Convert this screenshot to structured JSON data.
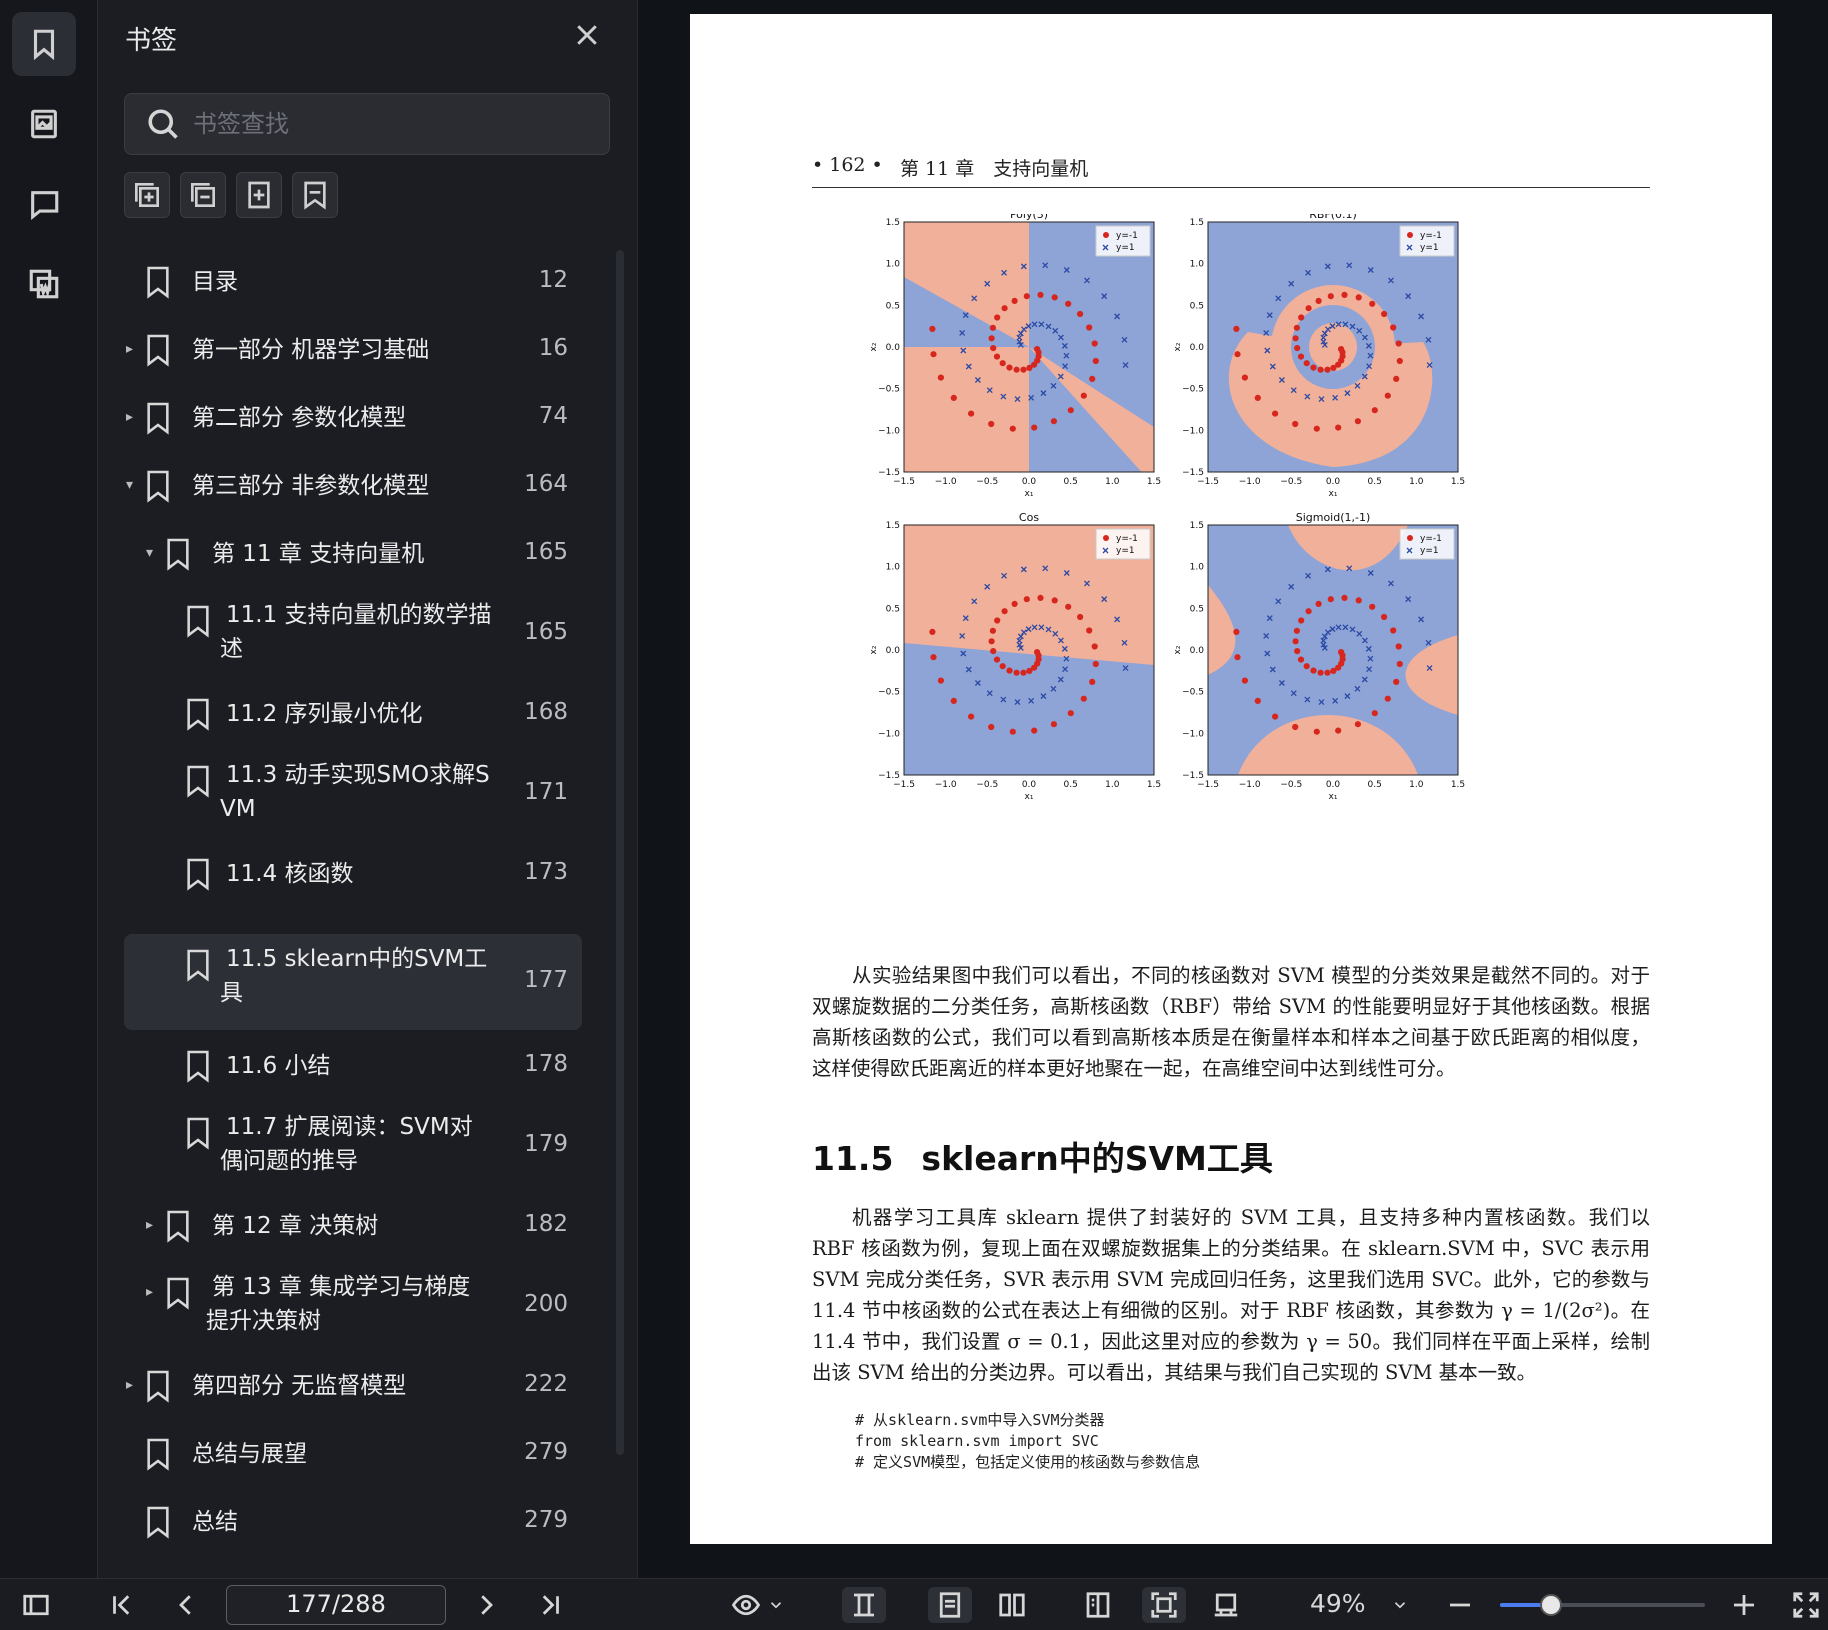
{
  "panel": {
    "title": "书签",
    "search_placeholder": "书签查找",
    "items": [
      {
        "label": "目录",
        "page": "12"
      },
      {
        "label": "第一部分 机器学习基础",
        "page": "16"
      },
      {
        "label": "第二部分 参数化模型",
        "page": "74"
      },
      {
        "label": "第三部分 非参数化模型",
        "page": "164"
      },
      {
        "label": "第 11 章 支持向量机",
        "page": "165"
      },
      {
        "label": "11.1 支持向量机的数学描",
        "label2": "述",
        "page": "165"
      },
      {
        "label": "11.2 序列最小优化",
        "page": "168"
      },
      {
        "label": "11.3 动手实现SMO求解S",
        "label2": "VM",
        "page": "171"
      },
      {
        "label": "11.4 核函数",
        "page": "173"
      },
      {
        "label": "11.5 sklearn中的SVM工",
        "label2": "具",
        "page": "177"
      },
      {
        "label": "11.6 小结",
        "page": "178"
      },
      {
        "label": "11.7 扩展阅读：SVM对",
        "label2": "偶问题的推导",
        "page": "179"
      },
      {
        "label": "第 12 章 决策树",
        "page": "182"
      },
      {
        "label": "第 13 章 集成学习与梯度",
        "label2": "提升决策树",
        "page": "200"
      },
      {
        "label": "第四部分 无监督模型",
        "page": "222"
      },
      {
        "label": "总结与展望",
        "page": "279"
      },
      {
        "label": "总结",
        "page": "279"
      }
    ]
  },
  "document": {
    "page_number": "• 162 •",
    "chapter_head": "第 11 章　支持向量机",
    "figure": {
      "panels": [
        {
          "title": "Poly(3)"
        },
        {
          "title": "RBF(0.1)"
        },
        {
          "title": "Cos"
        },
        {
          "title": "Sigmoid(1,-1)"
        }
      ],
      "legend": [
        "y=-1",
        "y=1"
      ],
      "ticks": [
        "−1.5",
        "−1.0",
        "−0.5",
        "0.0",
        "0.5",
        "1.0",
        "1.5"
      ],
      "xlabel": "x₁",
      "ylabel": "x₂"
    },
    "para1": "从实验结果图中我们可以看出，不同的核函数对 SVM 模型的分类效果是截然不同的。对于双螺旋数据的二分类任务，高斯核函数（RBF）带给 SVM 的性能要明显好于其他核函数。根据高斯核函数的公式，我们可以看到高斯核本质是在衡量样本和样本之间基于欧氏距离的相似度，这样使得欧氏距离近的样本更好地聚在一起，在高维空间中达到线性可分。",
    "section_num": "11.5",
    "section_title": "sklearn中的SVM工具",
    "para2": "机器学习工具库 sklearn 提供了封装好的 SVM 工具，且支持多种内置核函数。我们以 RBF 核函数为例，复现上面在双螺旋数据集上的分类结果。在 sklearn.SVM 中，SVC 表示用 SVM 完成分类任务，SVR 表示用 SVM 完成回归任务，这里我们选用 SVC。此外，它的参数与 11.4 节中核函数的公式在表达上有细微的区别。对于 RBF 核函数，其参数为 γ = 1/(2σ²)。在 11.4 节中，我们设置 σ = 0.1，因此这里对应的参数为 γ = 50。我们同样在平面上采样，绘制出该 SVM 给出的分类边界。可以看出，其结果与我们自己实现的 SVM 基本一致。",
    "code": [
      "# 从sklearn.svm中导入SVM分类器",
      "from sklearn.svm import SVC",
      "# 定义SVM模型，包括定义使用的核函数与参数信息"
    ]
  },
  "toolbar": {
    "page_indicator": "177/288",
    "zoom": "49%",
    "zoom_level": 0.25
  }
}
